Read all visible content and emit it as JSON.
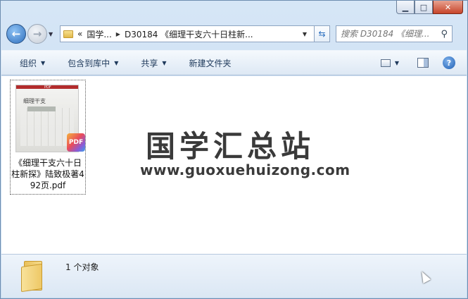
{
  "window": {
    "minimize_glyph": "▁",
    "maximize_glyph": "□",
    "close_glyph": "✕"
  },
  "nav": {
    "back_glyph": "←",
    "forward_glyph": "→",
    "history_glyph": "▼",
    "address_prefix": "«",
    "breadcrumb_root": "国学...",
    "breadcrumb_sep": "▶",
    "breadcrumb_current": "D30184 《细理干支六十日柱新...",
    "address_dropdown_glyph": "▼",
    "refresh_glyph": "⇆",
    "search_placeholder": "搜索 D30184 《细理...",
    "search_icon_glyph": "⚲"
  },
  "toolbar": {
    "organize": "组织",
    "include_library": "包含到库中",
    "share": "共享",
    "new_folder": "新建文件夹",
    "dropdown_glyph": "▼",
    "view_dropdown_glyph": "▼",
    "help_glyph": "?"
  },
  "file": {
    "name": "《细理干支六十日柱新探》陆致极著492页.pdf",
    "thumb_title": "细理干支",
    "thumb_header": "PDF",
    "badge": "PDF"
  },
  "watermark": {
    "title": "国学汇总站",
    "url": "www.guoxuehuizong.com"
  },
  "details": {
    "count_text": "1 个对象"
  },
  "colors": {
    "window_frame": "#c4d9ef",
    "toolbar_text": "#1e395b",
    "close_button": "#c7452b",
    "watermark": "#3a3a3a"
  },
  "icons": [
    "back-arrow-icon",
    "forward-arrow-icon",
    "folder-icon",
    "refresh-icon",
    "search-icon",
    "view-icon",
    "preview-pane-icon",
    "help-icon",
    "pdf-icon",
    "cursor-icon"
  ]
}
